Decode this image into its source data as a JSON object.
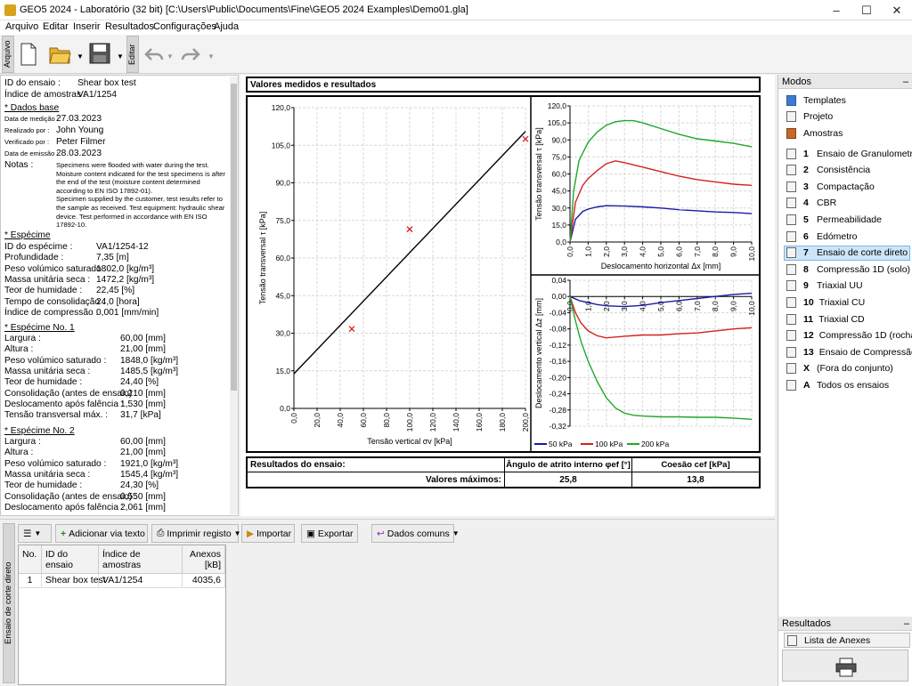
{
  "window": {
    "title": "GEO5 2024 - Laboratório (32 bit) [C:\\Users\\Public\\Documents\\Fine\\GEO5 2024 Examples\\Demo01.gla]"
  },
  "menu": [
    "Arquivo",
    "Editar",
    "Inserir",
    "Resultados",
    "Configurações",
    "Ajuda"
  ],
  "toolbar": {
    "arquivo_tab": "Arquivo",
    "editar_tab": "Editar"
  },
  "left": {
    "id_label": "ID do ensaio :",
    "id_value": "Shear box test",
    "sample_label": "Índice de amostras :",
    "sample_value": "VA1/1254",
    "dados_base": "* Dados base",
    "data_medicao_label": "Data de medição :",
    "data_medicao": "27.03.2023",
    "realizado_label": "Realizado por :",
    "realizado": "John Young",
    "verificado_label": "Verificado por :",
    "verificado": "Peter Filmer",
    "data_emissao_label": "Data de emissão :",
    "data_emissao": "28.03.2023",
    "notas_label": "Notas :",
    "notas": [
      "Specimens were flooded with water during the test.",
      "Moisture content indicated for the test specimens is after",
      "the end of the test (moisture content determined",
      "according to EN ISO 17892-01).",
      "Specimen supplied by the customer, test results refer to",
      "the sample as received. Test equipment: hydraulic shear",
      "device. Test performed in accordance with EN ISO",
      "17892-10."
    ],
    "especime_hdr": "* Espécime",
    "especime": [
      [
        "ID do espécime :",
        "VA1/1254-12"
      ],
      [
        "Profundidade :",
        "7,35 [m]"
      ],
      [
        "Peso volúmico saturado :",
        "1802,0 [kg/m³]"
      ],
      [
        "Massa unitária seca :",
        "1472,2 [kg/m³]"
      ],
      [
        "Teor de humidade :",
        "22,45 [%]"
      ],
      [
        "Tempo de consolidação :",
        "24,0 [hora]"
      ],
      [
        "Índice de compressão :",
        "0,001 [mm/min]"
      ]
    ],
    "esp1_hdr": "* Espécime No. 1",
    "esp1": [
      [
        "Largura :",
        "60,00 [mm]"
      ],
      [
        "Altura :",
        "21,00 [mm]"
      ],
      [
        "Peso volúmico saturado :",
        "1848,0 [kg/m³]"
      ],
      [
        "Massa unitária seca :",
        "1485,5 [kg/m³]"
      ],
      [
        "Teor de humidade :",
        "24,40 [%]"
      ],
      [
        "Consolidação (antes de ensaio) :",
        "0,210 [mm]"
      ],
      [
        "Deslocamento após falência :",
        "1,530 [mm]"
      ],
      [
        "Tensão transversal máx. :",
        "31,7 [kPa]"
      ]
    ],
    "esp2_hdr": "* Espécime No. 2",
    "esp2": [
      [
        "Largura :",
        "60,00 [mm]"
      ],
      [
        "Altura :",
        "21,00 [mm]"
      ],
      [
        "Peso volúmico saturado :",
        "1921,0 [kg/m³]"
      ],
      [
        "Massa unitária seca :",
        "1545,4 [kg/m³]"
      ],
      [
        "Teor de humidade :",
        "24,30 [%]"
      ],
      [
        "Consolidação (antes de ensaio) :",
        "0,550 [mm]"
      ],
      [
        "Deslocamento após falência :",
        "2,061 [mm]"
      ]
    ]
  },
  "center": {
    "header": "Valores medidos e resultados",
    "results_label": "Resultados do ensaio:",
    "col_phi": "Ângulo de atrito interno φef [°]",
    "col_c": "Coesão cef [kPa]",
    "row_label": "Valores máximos:",
    "phi_value": "25,8",
    "c_value": "13,8"
  },
  "chart_data": [
    {
      "type": "scatter",
      "title": "",
      "xlabel": "Tensão vertical σv [kPa]",
      "ylabel": "Tensão transversal τ [kPa]",
      "xlim": [
        0,
        200
      ],
      "ylim": [
        0,
        120
      ],
      "xticks": [
        "0,0",
        "20,0",
        "40,0",
        "60,0",
        "80,0",
        "100,0",
        "120,0",
        "140,0",
        "160,0",
        "180,0",
        "200,0"
      ],
      "yticks": [
        "0,0",
        "15,0",
        "30,0",
        "45,0",
        "60,0",
        "75,0",
        "90,0",
        "105,0",
        "120,0"
      ],
      "points": [
        [
          50,
          31.7
        ],
        [
          100,
          71.5
        ],
        [
          200,
          107.5
        ]
      ],
      "fit_line": [
        [
          0,
          13.8
        ],
        [
          200,
          110.5
        ]
      ],
      "grid": true
    },
    {
      "type": "line",
      "xlabel": "Deslocamento horizontal Δx [mm]",
      "ylabel": "Tensão transversal τ [kPa]",
      "xlim": [
        0,
        10
      ],
      "ylim": [
        0,
        120
      ],
      "xticks": [
        "0,0",
        "1,0",
        "2,0",
        "3,0",
        "4,0",
        "5,0",
        "6,0",
        "7,0",
        "8,0",
        "9,0",
        "10,0"
      ],
      "yticks": [
        "0,0",
        "15,0",
        "30,0",
        "45,0",
        "60,0",
        "75,0",
        "90,0",
        "105,0",
        "120,0"
      ],
      "series": [
        {
          "name": "50 kPa",
          "color": "#1a1aa8",
          "x": [
            0,
            0.3,
            0.7,
            1,
            1.5,
            2,
            3,
            4,
            5,
            6,
            7,
            8,
            9,
            10
          ],
          "y": [
            0,
            20,
            27,
            29,
            31,
            32,
            31.7,
            31,
            30,
            28.5,
            27.5,
            26.5,
            26,
            25
          ]
        },
        {
          "name": "100 kPa",
          "color": "#d42020",
          "x": [
            0,
            0.3,
            0.7,
            1,
            1.5,
            2,
            2.5,
            3,
            4,
            5,
            6,
            7,
            8,
            9,
            10
          ],
          "y": [
            0,
            35,
            50,
            56,
            63,
            69,
            71.5,
            70,
            66,
            62,
            58,
            55,
            53,
            51,
            50
          ]
        },
        {
          "name": "200 kPa",
          "color": "#1fa82a",
          "x": [
            0,
            0.2,
            0.5,
            1,
            1.5,
            2,
            2.5,
            3,
            3.5,
            4,
            5,
            6,
            7,
            8,
            9,
            10
          ],
          "y": [
            0,
            45,
            72,
            88,
            97,
            103,
            106,
            107,
            107,
            105,
            100,
            95,
            91,
            89,
            87,
            84
          ]
        }
      ]
    },
    {
      "type": "line",
      "xlabel": "",
      "ylabel": "Deslocamento vertical Δz [mm]",
      "xlim": [
        0,
        10
      ],
      "ylim": [
        -0.32,
        0.04
      ],
      "xticks": [
        "0,0",
        "1,0",
        "2,0",
        "3,0",
        "4,0",
        "5,0",
        "6,0",
        "7,0",
        "8,0",
        "9,0",
        "10,0"
      ],
      "yticks": [
        "0,04",
        "0,00",
        "-0,04",
        "-0,08",
        "-0,12",
        "-0,16",
        "-0,20",
        "-0,24",
        "-0,28",
        "-0,32"
      ],
      "series": [
        {
          "name": "50 kPa",
          "color": "#1a1aa8",
          "x": [
            0,
            0.5,
            1,
            1.5,
            2,
            3,
            4,
            5,
            6,
            7,
            8,
            9,
            10
          ],
          "y": [
            0,
            -0.01,
            -0.015,
            -0.02,
            -0.023,
            -0.025,
            -0.022,
            -0.015,
            -0.01,
            -0.005,
            0,
            0.005,
            0.008
          ]
        },
        {
          "name": "100 kPa",
          "color": "#d42020",
          "x": [
            0,
            0.3,
            0.6,
            1,
            1.5,
            2,
            3,
            4,
            5,
            6,
            7,
            8,
            9,
            10
          ],
          "y": [
            0,
            -0.04,
            -0.065,
            -0.085,
            -0.097,
            -0.102,
            -0.098,
            -0.095,
            -0.095,
            -0.092,
            -0.09,
            -0.085,
            -0.08,
            -0.077
          ]
        },
        {
          "name": "200 kPa",
          "color": "#1fa82a",
          "x": [
            0,
            0.3,
            0.6,
            1,
            1.5,
            2,
            2.5,
            3,
            3.5,
            4,
            5,
            6,
            7,
            8,
            9,
            10
          ],
          "y": [
            0,
            -0.06,
            -0.11,
            -0.16,
            -0.21,
            -0.25,
            -0.275,
            -0.288,
            -0.293,
            -0.295,
            -0.297,
            -0.297,
            -0.298,
            -0.298,
            -0.3,
            -0.303
          ]
        }
      ],
      "legend": [
        "50 kPa",
        "100 kPa",
        "200 kPa"
      ]
    }
  ],
  "right": {
    "modos_hdr": "Modos",
    "top_items": [
      "Templates",
      "Projeto",
      "Amostras"
    ],
    "tests": [
      [
        "1",
        "Ensaio de Granulometria"
      ],
      [
        "2",
        "Consistência"
      ],
      [
        "3",
        "Compactação"
      ],
      [
        "4",
        "CBR"
      ],
      [
        "5",
        "Permeabilidade"
      ],
      [
        "6",
        "Edómetro"
      ],
      [
        "7",
        "Ensaio de corte direto"
      ],
      [
        "8",
        "Compressão 1D (solo)"
      ],
      [
        "9",
        "Triaxial UU"
      ],
      [
        "10",
        "Triaxial CU"
      ],
      [
        "11",
        "Triaxial CD"
      ],
      [
        "12",
        "Compressão 1D (rocha)"
      ],
      [
        "13",
        "Ensaio de Compressão c..."
      ],
      [
        "X",
        "(Fora do conjunto)"
      ],
      [
        "A",
        "Todos os ensaios"
      ]
    ],
    "resultados_hdr": "Resultados",
    "lista_anexos": "Lista de Anexes"
  },
  "bottom": {
    "vtab": "Ensaio de corte direto",
    "btn_add": "Adicionar via texto",
    "btn_print": "Imprimir registo",
    "btn_import": "Importar",
    "btn_export": "Exportar",
    "btn_common": "Dados comuns",
    "columns": [
      "No.",
      "ID do ensaio",
      "Índice de amostras",
      "Anexos [kB]"
    ],
    "rows": [
      [
        "1",
        "Shear box test",
        "VA1/1254",
        "4035,6"
      ]
    ]
  }
}
